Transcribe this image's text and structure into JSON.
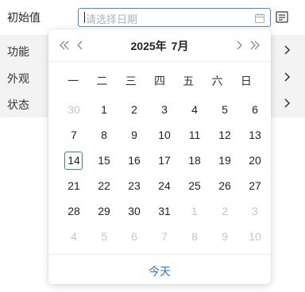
{
  "field": {
    "label": "初始值",
    "placeholder": "请选择日期"
  },
  "groups": [
    {
      "label": "功能"
    },
    {
      "label": "外观"
    },
    {
      "label": "状态"
    }
  ],
  "picker": {
    "year": "2025年",
    "month": "7月",
    "weekdays": [
      "一",
      "二",
      "三",
      "四",
      "五",
      "六",
      "日"
    ],
    "weeks": [
      [
        {
          "d": "30",
          "other": true
        },
        {
          "d": "1"
        },
        {
          "d": "2"
        },
        {
          "d": "3"
        },
        {
          "d": "4"
        },
        {
          "d": "5"
        },
        {
          "d": "6"
        }
      ],
      [
        {
          "d": "7"
        },
        {
          "d": "8"
        },
        {
          "d": "9"
        },
        {
          "d": "10"
        },
        {
          "d": "11"
        },
        {
          "d": "12"
        },
        {
          "d": "13"
        }
      ],
      [
        {
          "d": "14",
          "today": true
        },
        {
          "d": "15"
        },
        {
          "d": "16"
        },
        {
          "d": "17"
        },
        {
          "d": "18"
        },
        {
          "d": "19"
        },
        {
          "d": "20"
        }
      ],
      [
        {
          "d": "21"
        },
        {
          "d": "22"
        },
        {
          "d": "23"
        },
        {
          "d": "24"
        },
        {
          "d": "25"
        },
        {
          "d": "26"
        },
        {
          "d": "27"
        }
      ],
      [
        {
          "d": "28"
        },
        {
          "d": "29"
        },
        {
          "d": "30"
        },
        {
          "d": "31"
        },
        {
          "d": "1",
          "other": true
        },
        {
          "d": "2",
          "other": true
        },
        {
          "d": "3",
          "other": true
        }
      ],
      [
        {
          "d": "4",
          "other": true
        },
        {
          "d": "5",
          "other": true
        },
        {
          "d": "6",
          "other": true
        },
        {
          "d": "7",
          "other": true
        },
        {
          "d": "8",
          "other": true
        },
        {
          "d": "9",
          "other": true
        },
        {
          "d": "10",
          "other": true
        }
      ]
    ],
    "today_label": "今天"
  },
  "colors": {
    "accent": "#2f74cd",
    "input_border": "#4a86d8",
    "group_bg": "#f3f3f3",
    "muted": "#c5c5c5"
  }
}
